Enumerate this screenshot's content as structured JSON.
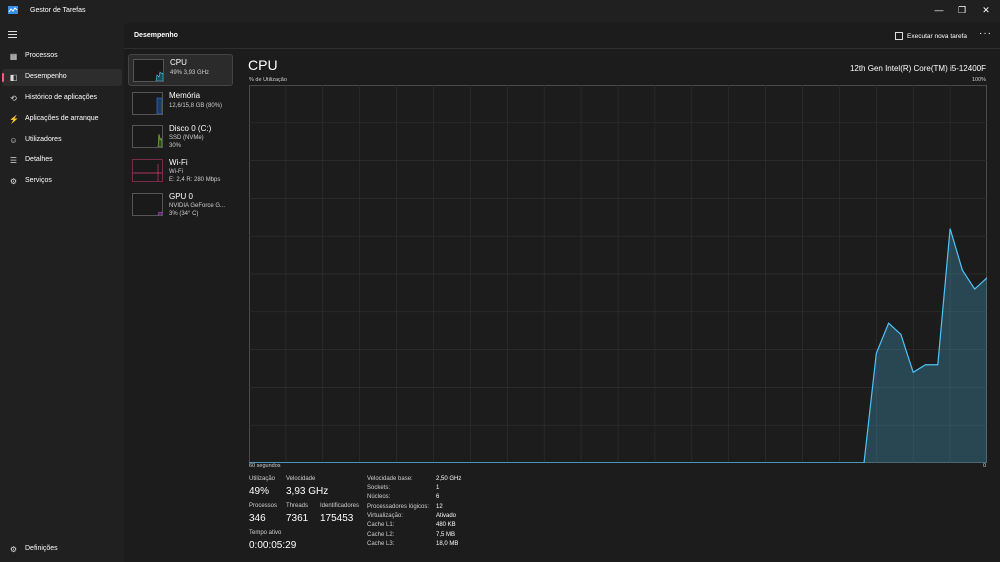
{
  "app": {
    "title": "Gestor de Tarefas"
  },
  "window_controls": {
    "minimize": "—",
    "restore": "❐",
    "close": "✕"
  },
  "nav": {
    "items": [
      {
        "label": "Processos",
        "icon": "processes-icon",
        "glyph": "▦"
      },
      {
        "label": "Desempenho",
        "icon": "performance-icon",
        "glyph": "◧"
      },
      {
        "label": "Histórico de aplicações",
        "icon": "history-icon",
        "glyph": "⟲"
      },
      {
        "label": "Aplicações de arranque",
        "icon": "startup-icon",
        "glyph": "⚡"
      },
      {
        "label": "Utilizadores",
        "icon": "users-icon",
        "glyph": "☺"
      },
      {
        "label": "Detalhes",
        "icon": "details-icon",
        "glyph": "☰"
      },
      {
        "label": "Serviços",
        "icon": "services-icon",
        "glyph": "⚙"
      }
    ],
    "settings_label": "Definições"
  },
  "header": {
    "title": "Desempenho",
    "run_task_label": "Executar nova tarefa",
    "more_label": "···"
  },
  "resources": [
    {
      "name": "CPU",
      "line1": "49%  3,93 GHz",
      "line2": "",
      "color": "#4fc3f7"
    },
    {
      "name": "Memória",
      "line1": "12,6/15,8 GB (80%)",
      "line2": "",
      "color": "#3a7bd5"
    },
    {
      "name": "Disco 0 (C:)",
      "line1": "SSD (NVMe)",
      "line2": "30%",
      "color": "#8bc34a"
    },
    {
      "name": "Wi-Fi",
      "line1": "Wi-Fi",
      "line2": "E: 2,4  R: 280 Mbps",
      "color": "#e0407b"
    },
    {
      "name": "GPU 0",
      "line1": "NVIDIA GeForce G...",
      "line2": "3% (34° C)",
      "color": "#b24ad8"
    }
  ],
  "main": {
    "title": "CPU",
    "model": "12th Gen Intel(R) Core(TM) i5-12400F",
    "y_label": "% de Utilização",
    "y_max": "100%",
    "x_label": "60 segundos",
    "x_min": "0"
  },
  "chart_data": {
    "type": "area",
    "series": [
      {
        "name": "",
        "values": [
          0,
          0,
          0,
          0,
          0,
          0,
          0,
          0,
          0,
          0,
          0,
          0,
          0,
          0,
          0,
          0,
          0,
          0,
          0,
          0,
          0,
          0,
          0,
          0,
          0,
          0,
          0,
          0,
          0,
          0,
          0,
          0,
          0,
          0,
          0,
          0,
          0,
          0,
          0,
          0,
          0,
          0,
          0,
          0,
          0,
          0,
          0,
          0,
          0,
          0,
          0,
          29,
          37,
          34,
          24,
          26,
          26,
          62,
          51,
          46,
          49
        ]
      }
    ],
    "ylim": [
      0,
      100
    ],
    "grid": true,
    "color": "#4fc3f7"
  },
  "stats": {
    "utilization": {
      "label": "Utilização",
      "value": "49%"
    },
    "speed": {
      "label": "Velocidade",
      "value": "3,93 GHz"
    },
    "processes": {
      "label": "Processos",
      "value": "346"
    },
    "threads": {
      "label": "Threads",
      "value": "7361"
    },
    "handles": {
      "label": "Identificadores",
      "value": "175453"
    },
    "uptime": {
      "label": "Tempo ativo",
      "value": "0:00:05:29"
    }
  },
  "specs": [
    {
      "label": "Velocidade base:",
      "value": "2,50 GHz"
    },
    {
      "label": "Sockets:",
      "value": "1"
    },
    {
      "label": "Núcleos:",
      "value": "6"
    },
    {
      "label": "Processadores lógicos:",
      "value": "12"
    },
    {
      "label": "Virtualização:",
      "value": "Ativado"
    },
    {
      "label": "Cache L1:",
      "value": "480 KB"
    },
    {
      "label": "Cache L2:",
      "value": "7,5 MB"
    },
    {
      "label": "Cache L3:",
      "value": "18,0 MB"
    }
  ]
}
